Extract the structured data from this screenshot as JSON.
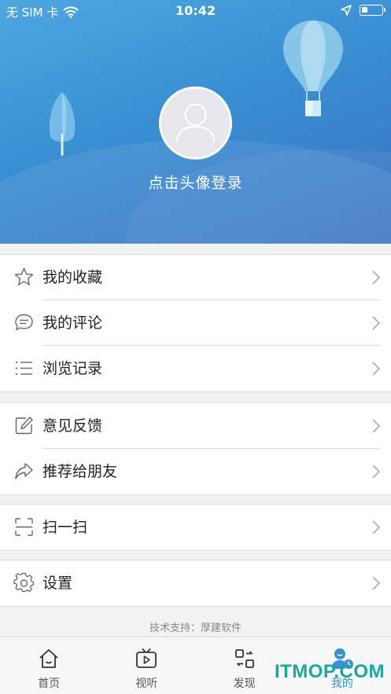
{
  "status_bar": {
    "carrier": "无 SIM 卡",
    "time": "10:42",
    "battery_level": 0.3
  },
  "header": {
    "login_prompt": "点击头像登录"
  },
  "menu_groups": [
    {
      "items": [
        {
          "label": "我的收藏",
          "icon": "star-icon"
        },
        {
          "label": "我的评论",
          "icon": "comment-icon"
        },
        {
          "label": "浏览记录",
          "icon": "list-icon"
        }
      ]
    },
    {
      "items": [
        {
          "label": "意见反馈",
          "icon": "edit-icon"
        },
        {
          "label": "推荐给朋友",
          "icon": "share-icon"
        }
      ]
    },
    {
      "items": [
        {
          "label": "扫一扫",
          "icon": "scan-icon"
        }
      ]
    },
    {
      "items": [
        {
          "label": "设置",
          "icon": "gear-icon"
        }
      ]
    }
  ],
  "footer": {
    "support_text": "技术支持：厚建软件"
  },
  "tabs": [
    {
      "label": "首页",
      "icon": "home-icon",
      "active": false
    },
    {
      "label": "视听",
      "icon": "tv-icon",
      "active": false
    },
    {
      "label": "发现",
      "icon": "discover-icon",
      "active": false
    },
    {
      "label": "我的",
      "icon": "profile-icon",
      "active": true
    }
  ],
  "watermark": "ITMOP.COM",
  "colors": {
    "accent": "#3a8fd3",
    "header_top": "#4da7de",
    "header_bottom": "#3a73c0",
    "watermark": "#1ba7a0"
  }
}
